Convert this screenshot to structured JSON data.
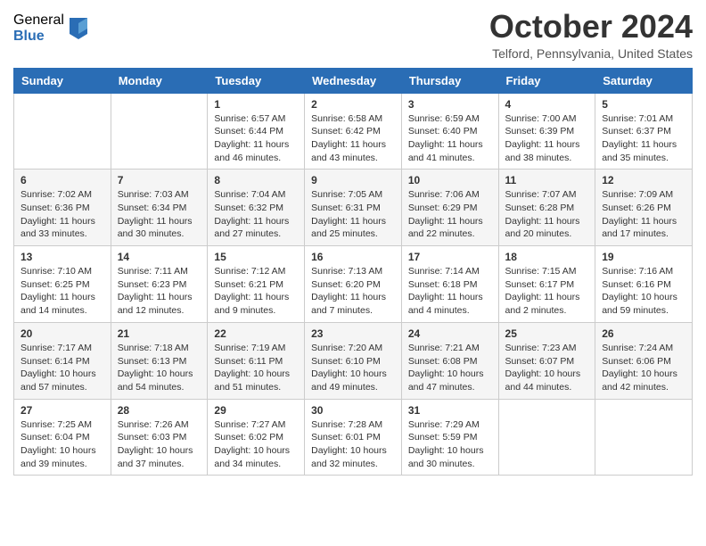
{
  "header": {
    "logo": {
      "general": "General",
      "blue": "Blue"
    },
    "title": "October 2024",
    "location": "Telford, Pennsylvania, United States"
  },
  "weekdays": [
    "Sunday",
    "Monday",
    "Tuesday",
    "Wednesday",
    "Thursday",
    "Friday",
    "Saturday"
  ],
  "weeks": [
    [
      {
        "day": "",
        "sunrise": "",
        "sunset": "",
        "daylight": ""
      },
      {
        "day": "",
        "sunrise": "",
        "sunset": "",
        "daylight": ""
      },
      {
        "day": "1",
        "sunrise": "Sunrise: 6:57 AM",
        "sunset": "Sunset: 6:44 PM",
        "daylight": "Daylight: 11 hours and 46 minutes."
      },
      {
        "day": "2",
        "sunrise": "Sunrise: 6:58 AM",
        "sunset": "Sunset: 6:42 PM",
        "daylight": "Daylight: 11 hours and 43 minutes."
      },
      {
        "day": "3",
        "sunrise": "Sunrise: 6:59 AM",
        "sunset": "Sunset: 6:40 PM",
        "daylight": "Daylight: 11 hours and 41 minutes."
      },
      {
        "day": "4",
        "sunrise": "Sunrise: 7:00 AM",
        "sunset": "Sunset: 6:39 PM",
        "daylight": "Daylight: 11 hours and 38 minutes."
      },
      {
        "day": "5",
        "sunrise": "Sunrise: 7:01 AM",
        "sunset": "Sunset: 6:37 PM",
        "daylight": "Daylight: 11 hours and 35 minutes."
      }
    ],
    [
      {
        "day": "6",
        "sunrise": "Sunrise: 7:02 AM",
        "sunset": "Sunset: 6:36 PM",
        "daylight": "Daylight: 11 hours and 33 minutes."
      },
      {
        "day": "7",
        "sunrise": "Sunrise: 7:03 AM",
        "sunset": "Sunset: 6:34 PM",
        "daylight": "Daylight: 11 hours and 30 minutes."
      },
      {
        "day": "8",
        "sunrise": "Sunrise: 7:04 AM",
        "sunset": "Sunset: 6:32 PM",
        "daylight": "Daylight: 11 hours and 27 minutes."
      },
      {
        "day": "9",
        "sunrise": "Sunrise: 7:05 AM",
        "sunset": "Sunset: 6:31 PM",
        "daylight": "Daylight: 11 hours and 25 minutes."
      },
      {
        "day": "10",
        "sunrise": "Sunrise: 7:06 AM",
        "sunset": "Sunset: 6:29 PM",
        "daylight": "Daylight: 11 hours and 22 minutes."
      },
      {
        "day": "11",
        "sunrise": "Sunrise: 7:07 AM",
        "sunset": "Sunset: 6:28 PM",
        "daylight": "Daylight: 11 hours and 20 minutes."
      },
      {
        "day": "12",
        "sunrise": "Sunrise: 7:09 AM",
        "sunset": "Sunset: 6:26 PM",
        "daylight": "Daylight: 11 hours and 17 minutes."
      }
    ],
    [
      {
        "day": "13",
        "sunrise": "Sunrise: 7:10 AM",
        "sunset": "Sunset: 6:25 PM",
        "daylight": "Daylight: 11 hours and 14 minutes."
      },
      {
        "day": "14",
        "sunrise": "Sunrise: 7:11 AM",
        "sunset": "Sunset: 6:23 PM",
        "daylight": "Daylight: 11 hours and 12 minutes."
      },
      {
        "day": "15",
        "sunrise": "Sunrise: 7:12 AM",
        "sunset": "Sunset: 6:21 PM",
        "daylight": "Daylight: 11 hours and 9 minutes."
      },
      {
        "day": "16",
        "sunrise": "Sunrise: 7:13 AM",
        "sunset": "Sunset: 6:20 PM",
        "daylight": "Daylight: 11 hours and 7 minutes."
      },
      {
        "day": "17",
        "sunrise": "Sunrise: 7:14 AM",
        "sunset": "Sunset: 6:18 PM",
        "daylight": "Daylight: 11 hours and 4 minutes."
      },
      {
        "day": "18",
        "sunrise": "Sunrise: 7:15 AM",
        "sunset": "Sunset: 6:17 PM",
        "daylight": "Daylight: 11 hours and 2 minutes."
      },
      {
        "day": "19",
        "sunrise": "Sunrise: 7:16 AM",
        "sunset": "Sunset: 6:16 PM",
        "daylight": "Daylight: 10 hours and 59 minutes."
      }
    ],
    [
      {
        "day": "20",
        "sunrise": "Sunrise: 7:17 AM",
        "sunset": "Sunset: 6:14 PM",
        "daylight": "Daylight: 10 hours and 57 minutes."
      },
      {
        "day": "21",
        "sunrise": "Sunrise: 7:18 AM",
        "sunset": "Sunset: 6:13 PM",
        "daylight": "Daylight: 10 hours and 54 minutes."
      },
      {
        "day": "22",
        "sunrise": "Sunrise: 7:19 AM",
        "sunset": "Sunset: 6:11 PM",
        "daylight": "Daylight: 10 hours and 51 minutes."
      },
      {
        "day": "23",
        "sunrise": "Sunrise: 7:20 AM",
        "sunset": "Sunset: 6:10 PM",
        "daylight": "Daylight: 10 hours and 49 minutes."
      },
      {
        "day": "24",
        "sunrise": "Sunrise: 7:21 AM",
        "sunset": "Sunset: 6:08 PM",
        "daylight": "Daylight: 10 hours and 47 minutes."
      },
      {
        "day": "25",
        "sunrise": "Sunrise: 7:23 AM",
        "sunset": "Sunset: 6:07 PM",
        "daylight": "Daylight: 10 hours and 44 minutes."
      },
      {
        "day": "26",
        "sunrise": "Sunrise: 7:24 AM",
        "sunset": "Sunset: 6:06 PM",
        "daylight": "Daylight: 10 hours and 42 minutes."
      }
    ],
    [
      {
        "day": "27",
        "sunrise": "Sunrise: 7:25 AM",
        "sunset": "Sunset: 6:04 PM",
        "daylight": "Daylight: 10 hours and 39 minutes."
      },
      {
        "day": "28",
        "sunrise": "Sunrise: 7:26 AM",
        "sunset": "Sunset: 6:03 PM",
        "daylight": "Daylight: 10 hours and 37 minutes."
      },
      {
        "day": "29",
        "sunrise": "Sunrise: 7:27 AM",
        "sunset": "Sunset: 6:02 PM",
        "daylight": "Daylight: 10 hours and 34 minutes."
      },
      {
        "day": "30",
        "sunrise": "Sunrise: 7:28 AM",
        "sunset": "Sunset: 6:01 PM",
        "daylight": "Daylight: 10 hours and 32 minutes."
      },
      {
        "day": "31",
        "sunrise": "Sunrise: 7:29 AM",
        "sunset": "Sunset: 5:59 PM",
        "daylight": "Daylight: 10 hours and 30 minutes."
      },
      {
        "day": "",
        "sunrise": "",
        "sunset": "",
        "daylight": ""
      },
      {
        "day": "",
        "sunrise": "",
        "sunset": "",
        "daylight": ""
      }
    ]
  ]
}
